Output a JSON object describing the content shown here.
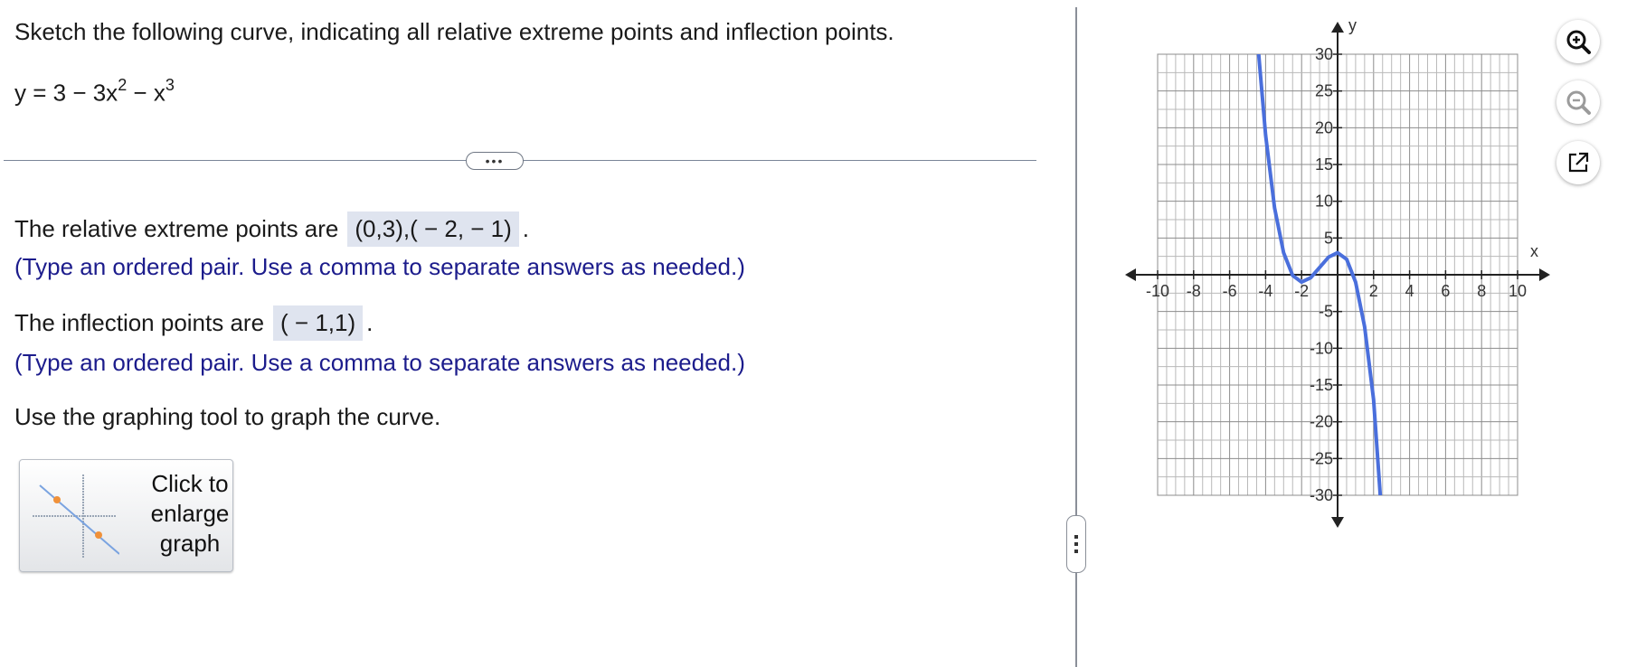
{
  "question": {
    "prompt": "Sketch the following curve, indicating all relative extreme points and inflection points.",
    "equation_lhs": "y = 3 − 3x",
    "equation_exp1": "2",
    "equation_mid": " − x",
    "equation_exp2": "3"
  },
  "divider": {
    "expand_label": "•••"
  },
  "answers": {
    "extreme_prefix": "The relative extreme points are",
    "extreme_value": "(0,3),( − 2, − 1)",
    "extreme_suffix": ".",
    "inflection_prefix": "The inflection points are",
    "inflection_value": "( − 1,1)",
    "inflection_suffix": ".",
    "hint": "(Type an ordered pair. Use a comma to separate answers as needed.)"
  },
  "instruction": "Use the graphing tool to graph the curve.",
  "enlarge_button": {
    "label": "Click to\nenlarge\ngraph"
  },
  "tools": [
    "zoom-in-icon",
    "zoom-out-icon",
    "open-new-window-icon"
  ],
  "colors": {
    "curve": "#4a6fdc",
    "hint_text": "#1c1c8c",
    "answer_bg": "#dfe4ef"
  },
  "chart_data": {
    "type": "line",
    "title": "",
    "xlabel": "x",
    "ylabel": "y",
    "xlim": [
      -10,
      10
    ],
    "ylim": [
      -30,
      30
    ],
    "x_ticks": [
      "-10",
      "-8",
      "-6",
      "-4",
      "-2",
      "2",
      "4",
      "6",
      "8",
      "10"
    ],
    "y_ticks": [
      "30",
      "25",
      "20",
      "15",
      "10",
      "5",
      "-5",
      "-10",
      "-15",
      "-20",
      "-25",
      "-30"
    ],
    "grid": true,
    "series": [
      {
        "x": [
          -4.6,
          -4,
          -3.5,
          -3,
          -2.5,
          -2,
          -1.5,
          -1,
          -0.5,
          0,
          0.5,
          1,
          1.5,
          2,
          2.4
        ],
        "y": [
          36.1,
          19,
          9.1,
          3,
          -0.1,
          -1,
          -0.4,
          1,
          2.4,
          3,
          2.1,
          -1,
          -7.1,
          -17,
          -31.1
        ]
      }
    ]
  }
}
